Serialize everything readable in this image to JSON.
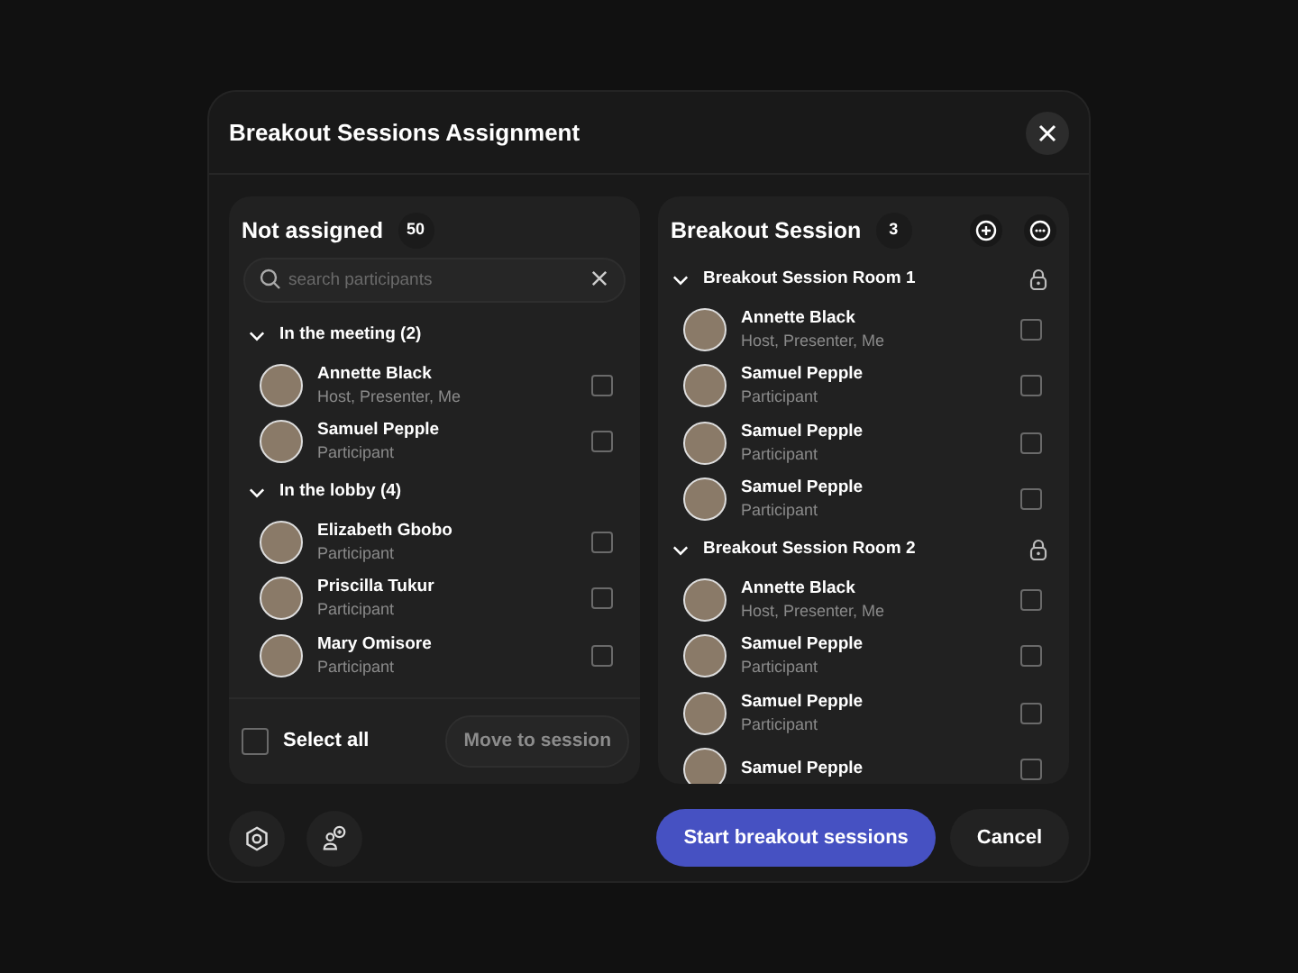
{
  "dialog": {
    "title": "Breakout Sessions Assignment"
  },
  "not_assigned": {
    "title": "Not assigned",
    "count": "50",
    "search": {
      "placeholder": "search participants"
    },
    "groups": [
      {
        "label": "In the meeting (2)",
        "expanded": true,
        "participants": [
          {
            "name": "Annette Black",
            "role": "Host, Presenter, Me",
            "checked": false
          },
          {
            "name": "Samuel Pepple",
            "role": "Participant",
            "checked": false
          }
        ]
      },
      {
        "label": "In the lobby (4)",
        "expanded": true,
        "participants": [
          {
            "name": "Elizabeth Gbobo",
            "role": "Participant",
            "checked": false
          },
          {
            "name": "Priscilla Tukur",
            "role": "Participant",
            "checked": false
          },
          {
            "name": "Mary Omisore",
            "role": "Participant",
            "checked": false
          }
        ]
      }
    ],
    "select_all": {
      "label": "Select all",
      "checked": false
    },
    "move_button": {
      "label": "Move to session",
      "disabled": true
    }
  },
  "breakout": {
    "title": "Breakout Session",
    "count": "3",
    "rooms": [
      {
        "label": "Breakout Session Room 1",
        "expanded": true,
        "participants": [
          {
            "name": "Annette Black",
            "role": "Host, Presenter, Me",
            "checked": false
          },
          {
            "name": "Samuel Pepple",
            "role": "Participant",
            "checked": false
          },
          {
            "name": "Samuel Pepple",
            "role": "Participant",
            "checked": false
          },
          {
            "name": "Samuel Pepple",
            "role": "Participant",
            "checked": false
          }
        ]
      },
      {
        "label": "Breakout Session Room 2",
        "expanded": true,
        "participants": [
          {
            "name": "Annette Black",
            "role": "Host, Presenter, Me",
            "checked": false
          },
          {
            "name": "Samuel Pepple",
            "role": "Participant",
            "checked": false
          },
          {
            "name": "Samuel Pepple",
            "role": "Participant",
            "checked": false
          },
          {
            "name": "Samuel Pepple",
            "checked": false
          }
        ]
      }
    ]
  },
  "footer": {
    "primary": "Start breakout sessions",
    "cancel": "Cancel"
  }
}
